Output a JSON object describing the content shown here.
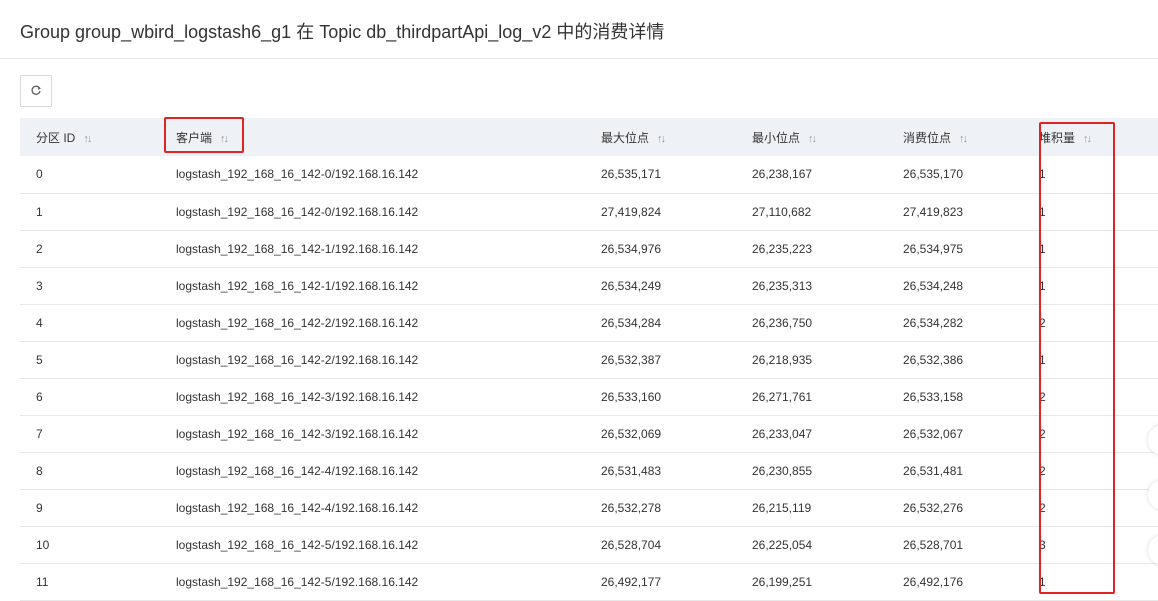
{
  "header": {
    "title": "Group group_wbird_logstash6_g1 在 Topic db_thirdpartApi_log_v2 中的消费详情"
  },
  "toolbar": {
    "refresh_icon": "refresh-icon"
  },
  "table": {
    "columns": [
      {
        "label": "分区 ID",
        "sortable": true
      },
      {
        "label": "客户端",
        "sortable": true
      },
      {
        "label": "最大位点",
        "sortable": true
      },
      {
        "label": "最小位点",
        "sortable": true
      },
      {
        "label": "消费位点",
        "sortable": true
      },
      {
        "label": "堆积量",
        "sortable": true
      }
    ],
    "rows": [
      [
        "0",
        "logstash_192_168_16_142-0/192.168.16.142",
        "26,535,171",
        "26,238,167",
        "26,535,170",
        "1"
      ],
      [
        "1",
        "logstash_192_168_16_142-0/192.168.16.142",
        "27,419,824",
        "27,110,682",
        "27,419,823",
        "1"
      ],
      [
        "2",
        "logstash_192_168_16_142-1/192.168.16.142",
        "26,534,976",
        "26,235,223",
        "26,534,975",
        "1"
      ],
      [
        "3",
        "logstash_192_168_16_142-1/192.168.16.142",
        "26,534,249",
        "26,235,313",
        "26,534,248",
        "1"
      ],
      [
        "4",
        "logstash_192_168_16_142-2/192.168.16.142",
        "26,534,284",
        "26,236,750",
        "26,534,282",
        "2"
      ],
      [
        "5",
        "logstash_192_168_16_142-2/192.168.16.142",
        "26,532,387",
        "26,218,935",
        "26,532,386",
        "1"
      ],
      [
        "6",
        "logstash_192_168_16_142-3/192.168.16.142",
        "26,533,160",
        "26,271,761",
        "26,533,158",
        "2"
      ],
      [
        "7",
        "logstash_192_168_16_142-3/192.168.16.142",
        "26,532,069",
        "26,233,047",
        "26,532,067",
        "2"
      ],
      [
        "8",
        "logstash_192_168_16_142-4/192.168.16.142",
        "26,531,483",
        "26,230,855",
        "26,531,481",
        "2"
      ],
      [
        "9",
        "logstash_192_168_16_142-4/192.168.16.142",
        "26,532,278",
        "26,215,119",
        "26,532,276",
        "2"
      ],
      [
        "10",
        "logstash_192_168_16_142-5/192.168.16.142",
        "26,528,704",
        "26,225,054",
        "26,528,701",
        "3"
      ],
      [
        "11",
        "logstash_192_168_16_142-5/192.168.16.142",
        "26,492,177",
        "26,199,251",
        "26,492,176",
        "1"
      ]
    ]
  },
  "colors": {
    "header_bg": "#eef1f6",
    "highlight": "#e02424",
    "border": "#e8e8e8"
  }
}
